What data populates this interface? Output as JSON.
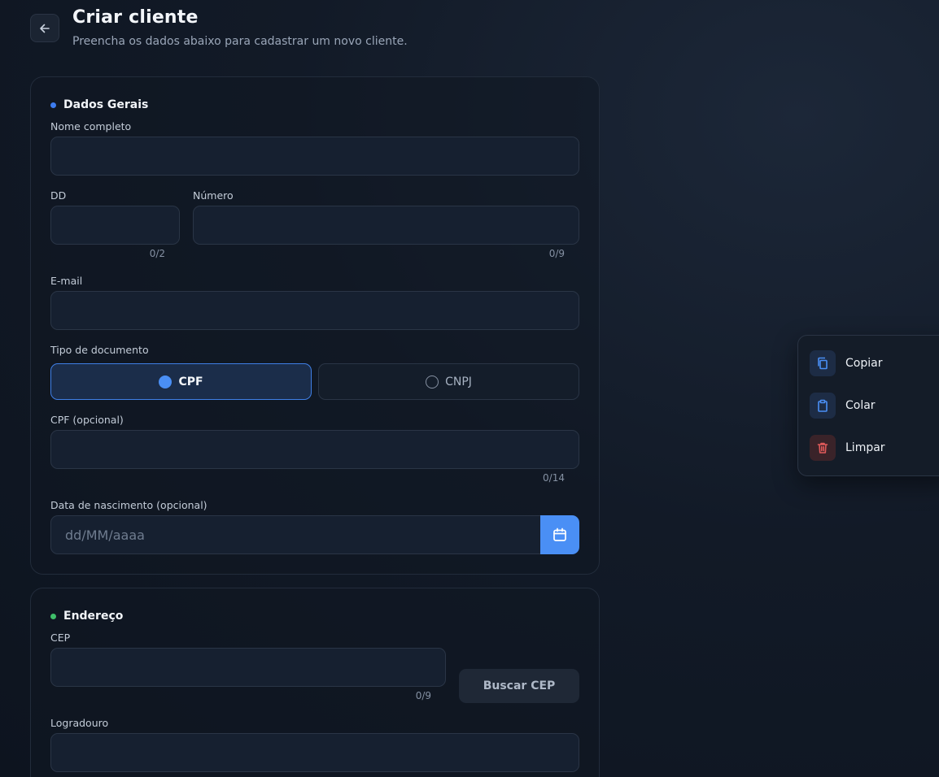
{
  "header": {
    "title": "Criar cliente",
    "subtitle": "Preencha os dados abaixo para cadastrar um novo cliente."
  },
  "general": {
    "section_title": "Dados Gerais",
    "dot_color": "#3d7cf0",
    "name_label": "Nome completo",
    "name_value": "",
    "ddd_label": "DD",
    "ddd_counter": "0/2",
    "number_label": "Número",
    "number_counter": "0/9",
    "email_label": "E-mail",
    "doc_type_label": "Tipo de documento",
    "doc_options": [
      "CPF",
      "CNPJ"
    ],
    "doc_selected": "CPF",
    "cpf_label": "CPF (opcional)",
    "cpf_counter": "0/14",
    "birth_label": "Data de nascimento (opcional)",
    "birth_placeholder": "dd/MM/aaaa"
  },
  "address": {
    "section_title": "Endereço",
    "dot_color": "#3fbf6a",
    "cep_label": "CEP",
    "cep_counter": "0/9",
    "search_cep_label": "Buscar CEP",
    "street_label": "Logradouro"
  },
  "context_menu": {
    "items": [
      {
        "label": "Copiar",
        "icon": "copy-icon",
        "color": "#4a8ff5"
      },
      {
        "label": "Colar",
        "icon": "clipboard-icon",
        "color": "#4a8ff5"
      },
      {
        "label": "Limpar",
        "icon": "trash-icon",
        "color": "#e05a5a"
      }
    ]
  },
  "colors": {
    "accent": "#4a8ff5",
    "danger": "#e05a5a"
  }
}
